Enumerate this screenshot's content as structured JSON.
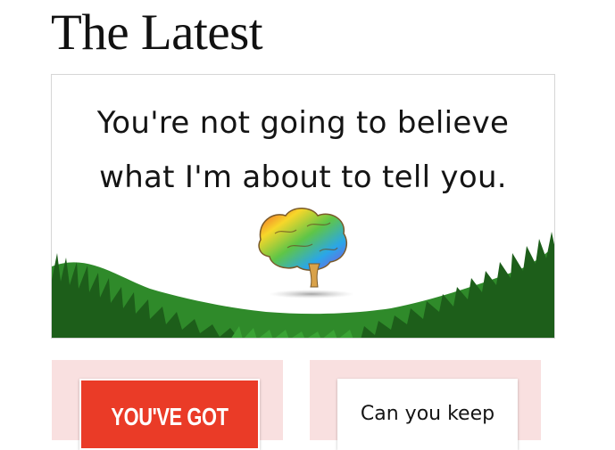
{
  "page": {
    "title": "The Latest"
  },
  "hero": {
    "line1": "You're not going to believe",
    "line2": "what I'm about to tell you."
  },
  "cards": [
    {
      "text": "YOU'VE GOT"
    },
    {
      "text": "Can you keep"
    }
  ],
  "colors": {
    "card_bg": "#f9e0e0",
    "red_thumb": "#ea3b27",
    "grass": "#2f8a2a"
  }
}
